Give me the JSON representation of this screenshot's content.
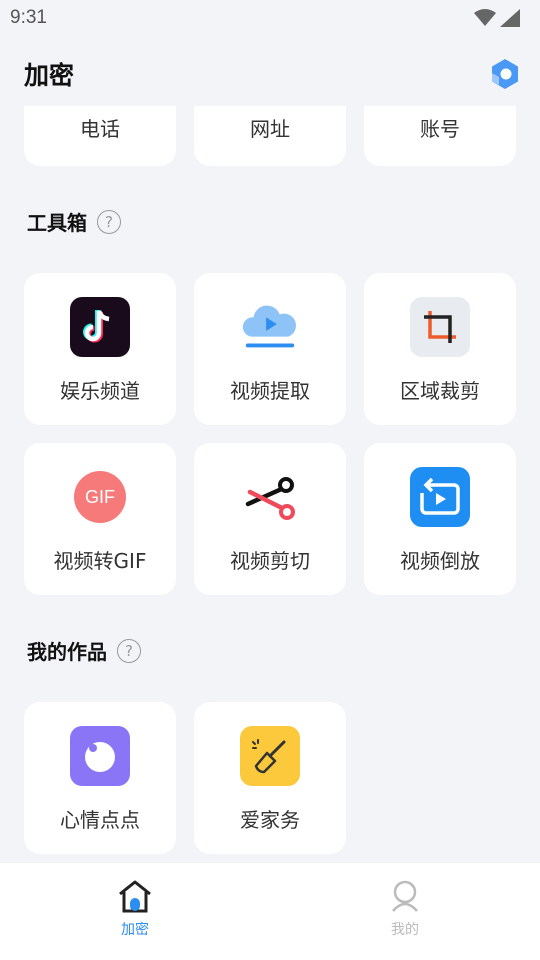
{
  "status": {
    "time": "9:31"
  },
  "header": {
    "title": "加密",
    "logo_icon": "app-logo-icon"
  },
  "top_row": [
    "电话",
    "网址",
    "账号"
  ],
  "toolbox": {
    "title": "工具箱",
    "help": "?",
    "items": [
      {
        "label": "娱乐频道",
        "icon": "tiktok-icon"
      },
      {
        "label": "视频提取",
        "icon": "cloud-play-icon"
      },
      {
        "label": "区域裁剪",
        "icon": "crop-icon"
      },
      {
        "label": "视频转GIF",
        "icon": "gif-icon",
        "icon_text": "GIF"
      },
      {
        "label": "视频剪切",
        "icon": "scissors-icon"
      },
      {
        "label": "视频倒放",
        "icon": "reverse-play-icon"
      }
    ]
  },
  "works": {
    "title": "我的作品",
    "help": "?",
    "items": [
      {
        "label": "心情点点",
        "icon": "mood-icon"
      },
      {
        "label": "爱家务",
        "icon": "broom-icon"
      }
    ]
  },
  "nav": {
    "items": [
      {
        "label": "加密",
        "icon": "home-lock-icon",
        "active": true
      },
      {
        "label": "我的",
        "icon": "profile-icon",
        "active": false
      }
    ]
  },
  "colors": {
    "accent": "#2c8ef0",
    "background": "#f3f4f8",
    "card": "#ffffff"
  }
}
